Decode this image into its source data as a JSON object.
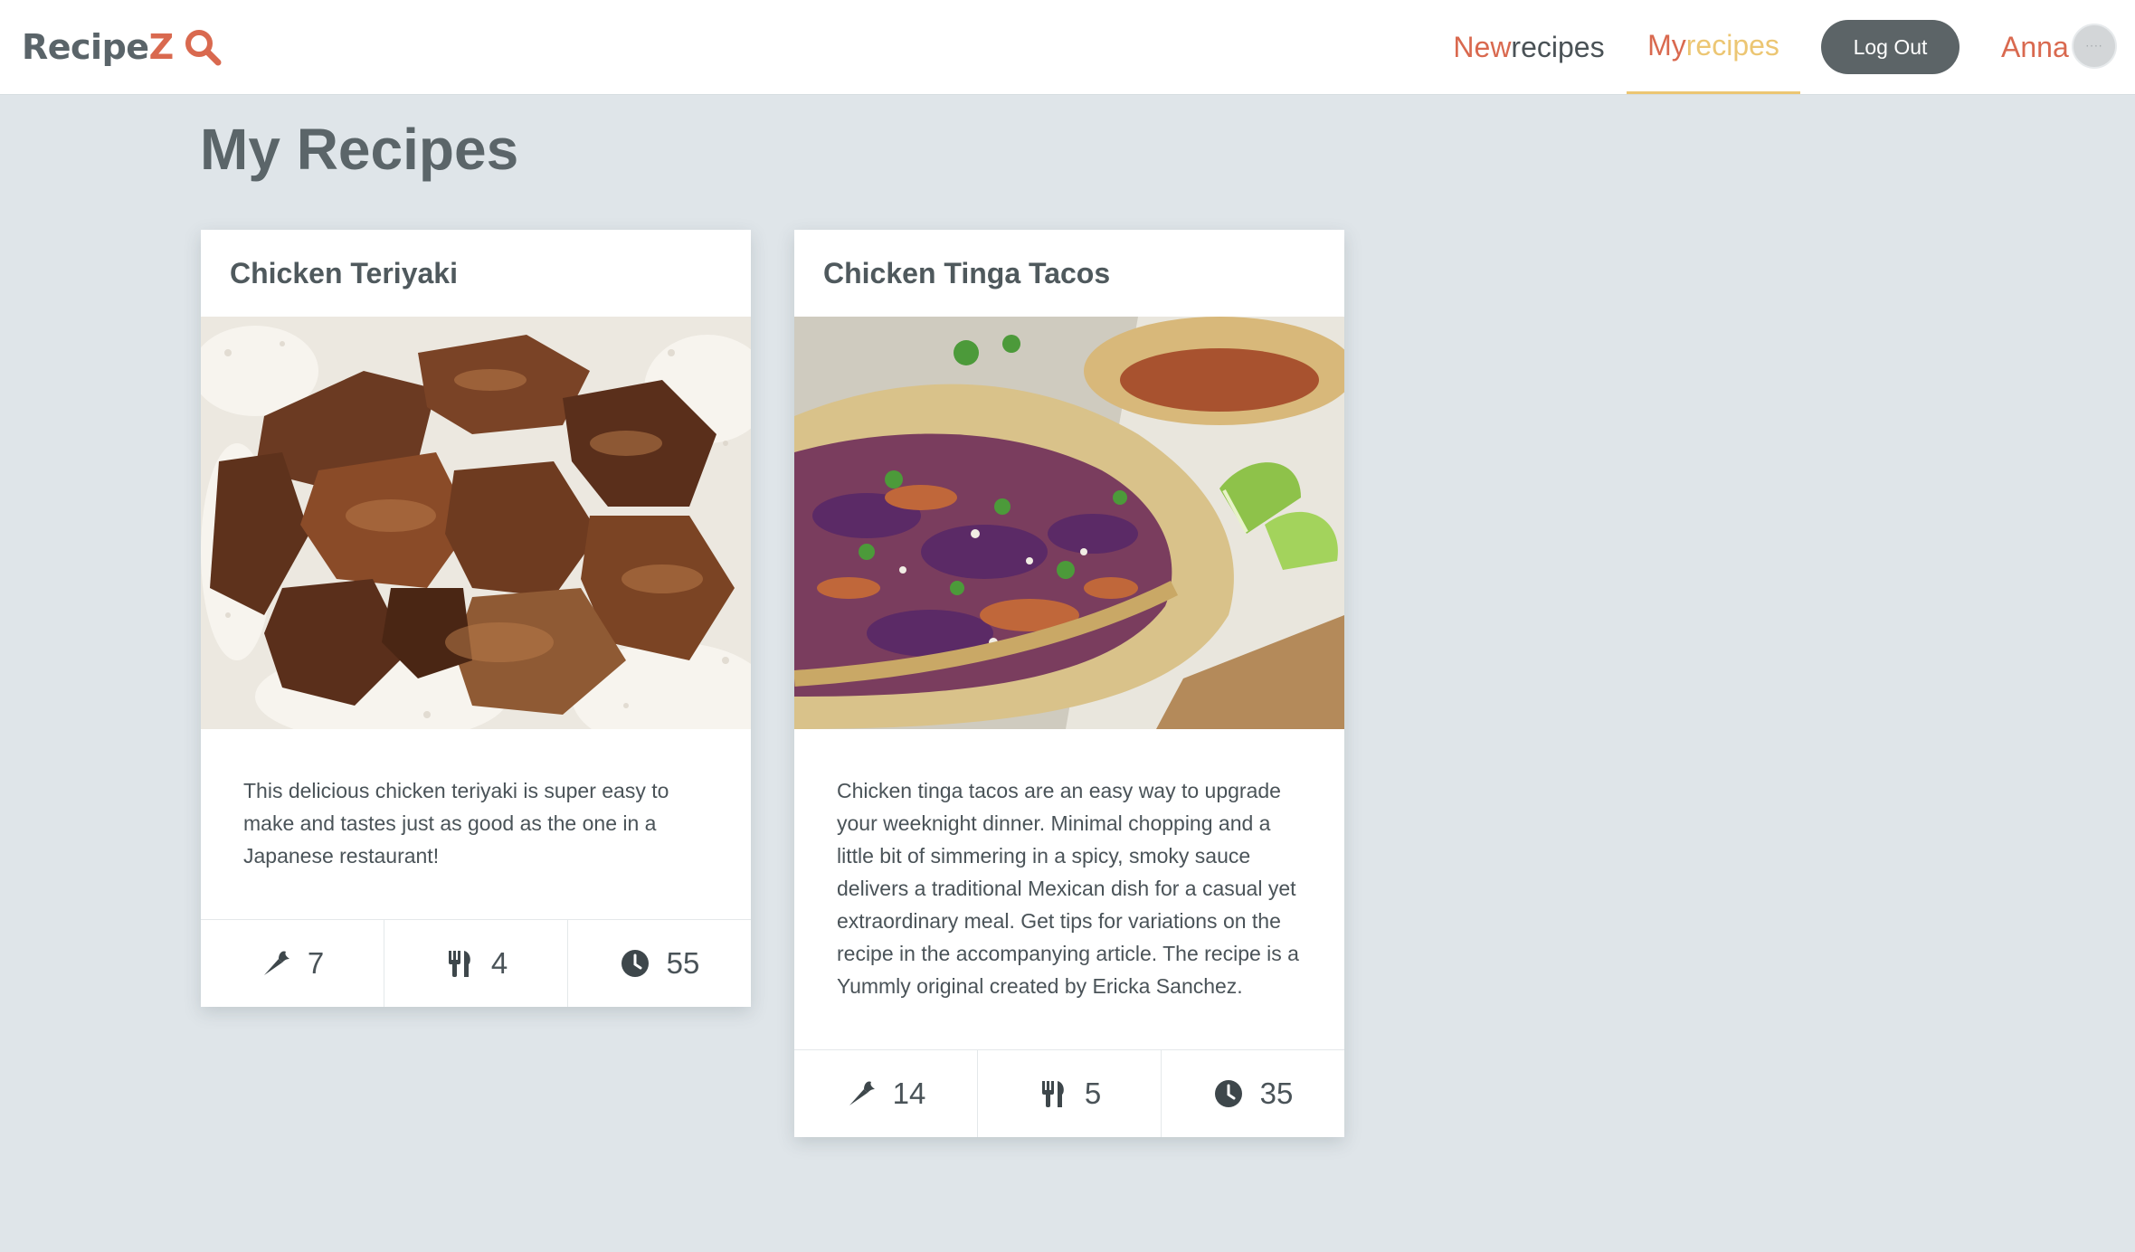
{
  "brand": {
    "part1": "Recipe",
    "part2": "Z",
    "icon": "search-icon"
  },
  "nav": {
    "new_recipes": {
      "part1": "New",
      "part2": "recipes"
    },
    "my_recipes": {
      "part1": "My",
      "part2": "recipes",
      "active": true
    },
    "logout_label": "Log Out",
    "username": "Anna",
    "avatar_text": "····"
  },
  "colors": {
    "accent": "#d9694f",
    "active_tab": "#ecc673",
    "background": "#dfe5e9",
    "button": "#5c6467"
  },
  "page": {
    "title": "My Recipes"
  },
  "recipes": [
    {
      "title": "Chicken Teriyaki",
      "description": "This delicious chicken teriyaki is super easy to make and tastes just as good as the one in a Japanese restaurant!",
      "ingredients": "7",
      "servings": "4",
      "time": "55",
      "image": "chicken-teriyaki-photo"
    },
    {
      "title": "Chicken Tinga Tacos",
      "description": "Chicken tinga tacos are an easy way to upgrade your weeknight dinner. Minimal chopping and a little bit of simmering in a spicy, smoky sauce delivers a traditional Mexican dish for a casual yet extraordinary meal. Get tips for variations on the recipe in the accompanying article. The recipe is a Yummly original created by Ericka Sanchez.",
      "ingredients": "14",
      "servings": "5",
      "time": "35",
      "image": "chicken-tinga-tacos-photo"
    }
  ],
  "icons": {
    "ingredients": "carrot-icon",
    "servings": "utensils-icon",
    "time": "clock-icon"
  }
}
